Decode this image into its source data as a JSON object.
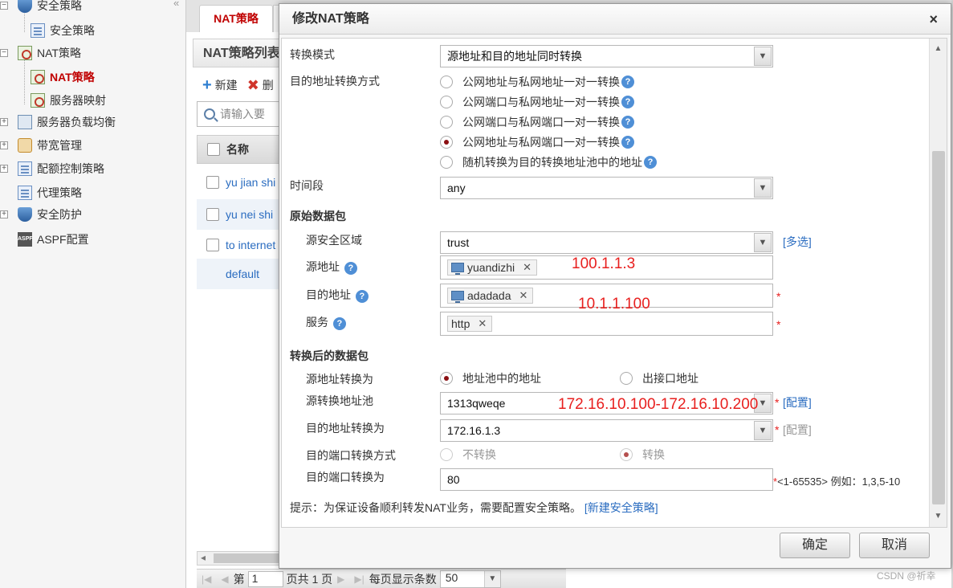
{
  "sidebar": {
    "items": [
      {
        "label": "安全策略",
        "toggle": "−"
      },
      {
        "label": "安全策略"
      },
      {
        "label": "NAT策略",
        "toggle": "−"
      },
      {
        "label": "NAT策略"
      },
      {
        "label": "服务器映射"
      },
      {
        "label": "服务器负载均衡",
        "toggle": "+"
      },
      {
        "label": "带宽管理",
        "toggle": "+"
      },
      {
        "label": "配额控制策略",
        "toggle": "+"
      },
      {
        "label": "代理策略"
      },
      {
        "label": "安全防护",
        "toggle": "+"
      },
      {
        "label": "ASPF配置"
      }
    ],
    "collapse_glyph": "«"
  },
  "main": {
    "tab": "NAT策略",
    "panel_title": "NAT策略列表",
    "toolbar": {
      "new": "新建",
      "delete": "删"
    },
    "search_placeholder": "请输入要",
    "grid": {
      "header": "名称",
      "rows": [
        "yu jian shi",
        "yu  nei  shi",
        "to internet",
        "default"
      ]
    },
    "pager": {
      "page_label": "第",
      "page": "1",
      "total": "页共 1 页",
      "per_page_label": "每页显示条数",
      "per_page": "50"
    }
  },
  "dialog": {
    "title": "修改NAT策略",
    "close": "×",
    "fields": {
      "mode_label": "转换模式",
      "mode_value": "源地址和目的地址同时转换",
      "dest_method_label": "目的地址转换方式",
      "dest_methods": [
        {
          "label": "公网地址与私网地址一对一转换",
          "selected": false
        },
        {
          "label": "公网端口与私网地址一对一转换",
          "selected": false
        },
        {
          "label": "公网端口与私网端口一对一转换",
          "selected": false
        },
        {
          "label": "公网地址与私网端口一对一转换",
          "selected": true
        },
        {
          "label": "随机转换为目的转换地址池中的地址",
          "selected": false
        }
      ],
      "time_label": "时间段",
      "time_value": "any",
      "orig_section": "原始数据包",
      "src_zone_label": "源安全区域",
      "src_zone_value": "trust",
      "multi_select": "[多选]",
      "src_addr_label": "源地址",
      "src_addr_tag": "yuandizhi",
      "src_addr_note": "100.1.1.3",
      "dst_addr_label": "目的地址",
      "dst_addr_tag": "adadada",
      "dst_addr_note": "10.1.1.100",
      "service_label": "服务",
      "service_tag": "http",
      "required": "*",
      "trans_section": "转换后的数据包",
      "src_trans_label": "源地址转换为",
      "src_trans_opt1": "地址池中的地址",
      "src_trans_opt2": "出接口地址",
      "src_pool_label": "源转换地址池",
      "src_pool_value": "1313qweqe",
      "src_pool_note": "172.16.10.100-172.16.10.200",
      "config_link": "[配置]",
      "dst_trans_label": "目的地址转换为",
      "dst_trans_value": "172.16.1.3",
      "config_disabled": "[配置]",
      "port_method_label": "目的端口转换方式",
      "port_opt1": "不转换",
      "port_opt2": "转换",
      "port_label": "目的端口转换为",
      "port_value": "80",
      "port_hint": "*<1-65535> 例如：1,3,5-10",
      "tip": "提示：为保证设备顺利转发NAT业务，需要配置安全策略。",
      "tip_link": "[新建安全策略]"
    },
    "ok": "确定",
    "cancel": "取消",
    "help_glyph": "?"
  },
  "watermark": "CSDN @祈幸"
}
